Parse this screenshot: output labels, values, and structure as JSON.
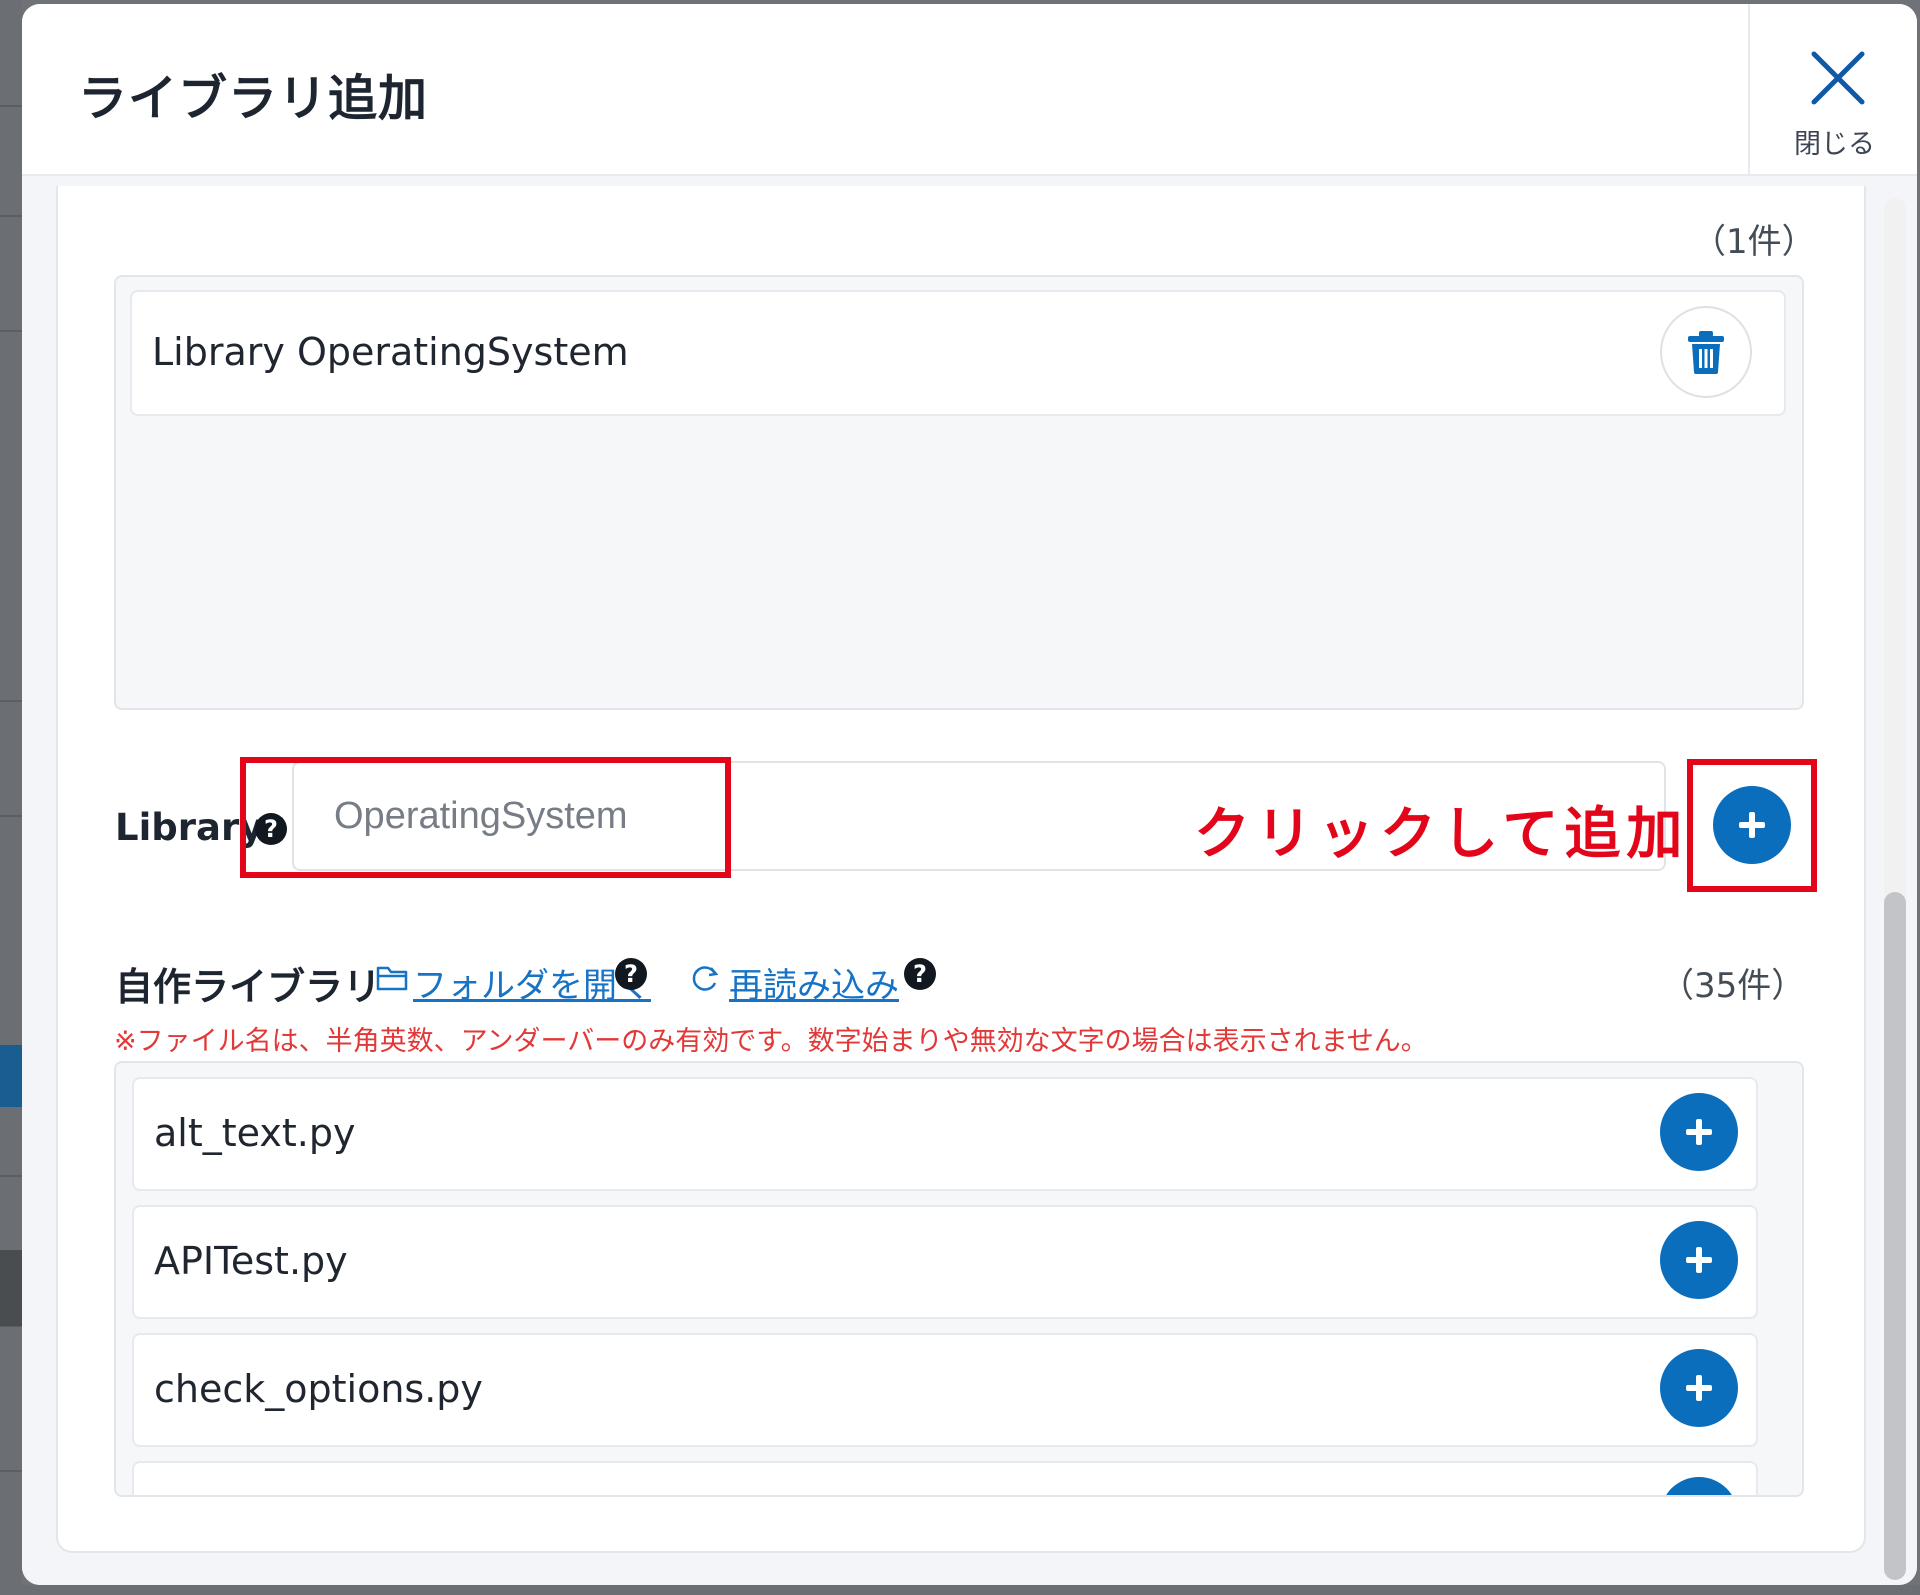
{
  "dialog": {
    "title": "ライブラリ追加",
    "close_label": "閉じる"
  },
  "selected": {
    "count": "（1件）",
    "items": [
      {
        "label": "Library OperatingSystem"
      }
    ]
  },
  "library_field": {
    "label": "Library",
    "placeholder": "OperatingSystem",
    "help_icon": "?"
  },
  "annotation": {
    "text": "クリックして追加",
    "color": "#e3061a"
  },
  "custom_libraries": {
    "label": "自作ライブラリ",
    "open_folder_label": "フォルダを開く",
    "reload_label": "再読み込み",
    "count": "（35件）",
    "warning": "※ファイル名は、半角英数、アンダーバーのみ有効です。数字始まりや無効な文字の場合は表示されません。",
    "items": [
      {
        "label": "alt_text.py"
      },
      {
        "label": "APITest.py"
      },
      {
        "label": "check_options.py"
      }
    ]
  },
  "colors": {
    "accent": "#0a6ebd",
    "link": "#1673c6",
    "warning": "#e23838"
  },
  "icons": {
    "close": "close-icon",
    "delete": "trash-icon",
    "add": "plus-icon",
    "folder": "folder-icon",
    "reload": "reload-icon",
    "help": "help-icon"
  }
}
